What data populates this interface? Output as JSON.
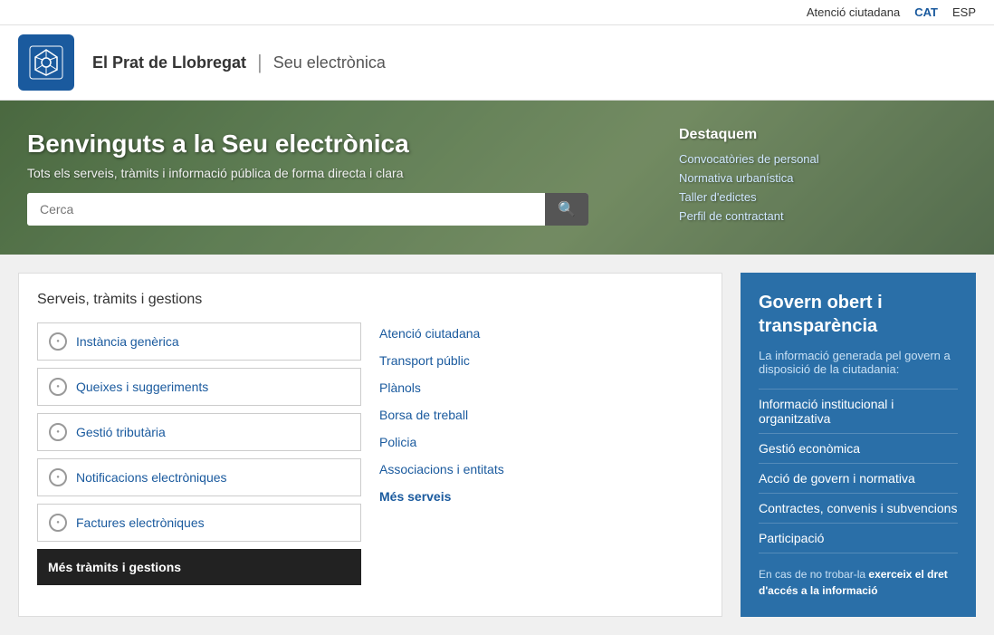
{
  "topbar": {
    "atencio_label": "Atenció ciutadana",
    "cat_label": "CAT",
    "esp_label": "ESP"
  },
  "header": {
    "city": "El Prat de Llobregat",
    "divider": "|",
    "subtitle": "Seu electrònica"
  },
  "hero": {
    "title": "Benvinguts a la Seu electrònica",
    "subtitle": "Tots els serveis, tràmits i informació pública de forma directa i clara",
    "search_placeholder": "Cerca",
    "destacats_title": "Destaquem",
    "links": [
      {
        "label": "Convocatòries de personal"
      },
      {
        "label": "Normativa urbanística"
      },
      {
        "label": "Taller d'edictes"
      },
      {
        "label": "Perfil de contractant"
      }
    ]
  },
  "services": {
    "section_title": "Serveis, tràmits i gestions",
    "left_items": [
      {
        "label": "Instància genèrica"
      },
      {
        "label": "Queixes i suggeriments"
      },
      {
        "label": "Gestió tributària"
      },
      {
        "label": "Notificacions electròniques"
      },
      {
        "label": "Factures electròniques"
      }
    ],
    "more_label": "Més tràmits i gestions",
    "right_items": [
      {
        "label": "Atenció ciutadana"
      },
      {
        "label": "Transport públic"
      },
      {
        "label": "Plànols"
      },
      {
        "label": "Borsa de treball"
      },
      {
        "label": "Policia"
      },
      {
        "label": "Associacions i entitats"
      }
    ],
    "more_services_label": "Més serveis"
  },
  "govern": {
    "title": "Govern obert i transparència",
    "intro": "La informació generada pel govern a disposició de la ciutadania:",
    "items": [
      {
        "label": "Informació institucional i organitzativa"
      },
      {
        "label": "Gestió econòmica"
      },
      {
        "label": "Acció de govern i normativa"
      },
      {
        "label": "Contractes, convenis i subvencions"
      },
      {
        "label": "Participació"
      }
    ],
    "footer": "En cas de no trobar-la ",
    "footer_bold": "exerceix el dret d'accés a la informació"
  }
}
